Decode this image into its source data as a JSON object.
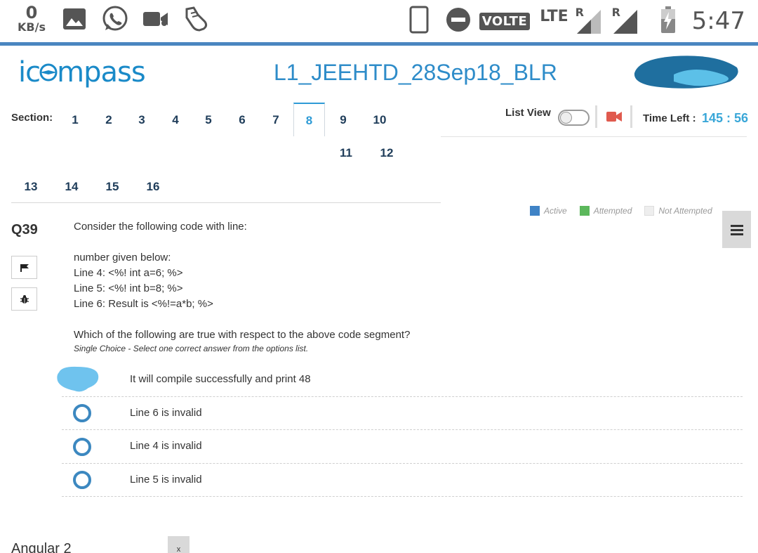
{
  "status_bar": {
    "speed_value": "0",
    "speed_unit": "KB/s",
    "volte": "VOLTE",
    "lte": "LTE",
    "sim1": "R",
    "sim2": "R",
    "time": "5:47",
    "icons": [
      "gallery-icon",
      "whatsapp-icon",
      "video-call-icon",
      "shoe-icon",
      "phone-outline-icon",
      "do-not-disturb-icon",
      "signal-icon",
      "battery-charging-icon"
    ]
  },
  "header": {
    "logo_prefix": "ic",
    "logo_suffix": "mpass",
    "exam_title": "L1_JEEHTD_28Sep18_BLR"
  },
  "sections": {
    "label": "Section:",
    "items": [
      "1",
      "2",
      "3",
      "4",
      "5",
      "6",
      "7",
      "8",
      "9",
      "10",
      "11",
      "12",
      "13",
      "14",
      "15",
      "16"
    ],
    "active": "8"
  },
  "controls": {
    "list_view_label": "List View",
    "time_left_label": "Time Left :",
    "time_left_value": "145 : 56"
  },
  "legend": {
    "active": "Active",
    "attempted": "Attempted",
    "not_attempted": "Not Attempted",
    "colors": {
      "active": "#3f83c6",
      "attempted": "#5cb85c",
      "not_attempted": "#eeeeee"
    }
  },
  "question": {
    "number": "Q39",
    "lines": [
      "Consider the following code with line:",
      "number given below:",
      "Line 4: <%! int a=6; %>",
      "Line 5: <%! int b=8; %>",
      "Line 6: Result is <%!=a*b; %>",
      "Which of the following are true with respect to the above code segment?"
    ],
    "hint": "Single Choice - Select one correct answer from the options list.",
    "options": [
      "It will compile successfully and print 48",
      "Line 6 is invalid",
      "Line 4 is invalid",
      "Line 5 is invalid"
    ]
  },
  "footer": {
    "text": "Angular 2",
    "close": "x"
  }
}
